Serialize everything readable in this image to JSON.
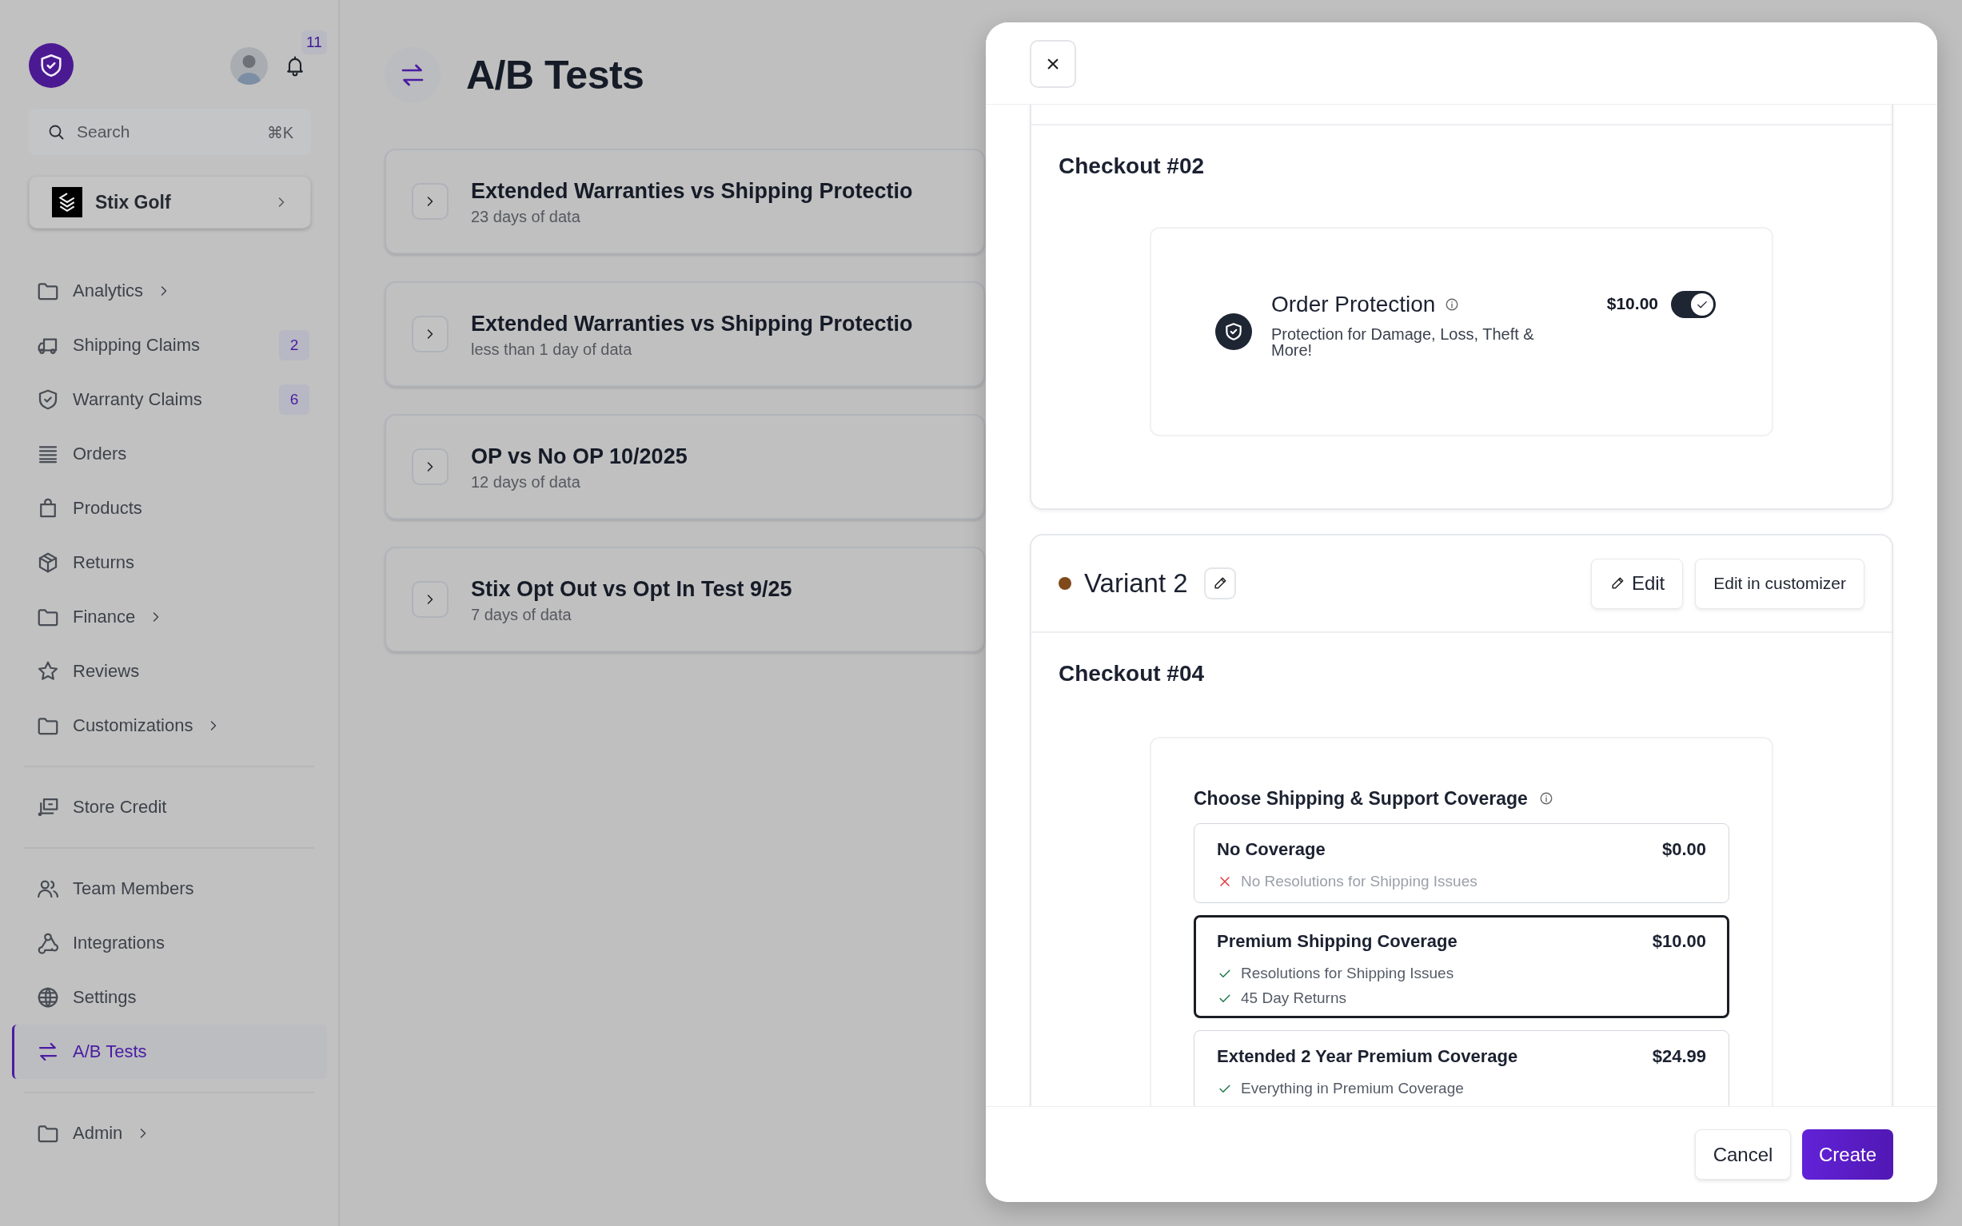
{
  "sidebar": {
    "notifications": "11",
    "search": {
      "placeholder": "Search",
      "shortcut": "⌘K"
    },
    "store": {
      "name": "Stix Golf"
    },
    "sections": [
      {
        "items": [
          {
            "label": "Analytics",
            "submenu": true,
            "selected": false
          },
          {
            "label": "Shipping Claims",
            "badge": "2",
            "submenu": false,
            "selected": false
          },
          {
            "label": "Warranty Claims",
            "badge": "6",
            "submenu": false,
            "selected": false
          },
          {
            "label": "Orders",
            "submenu": false,
            "selected": false
          },
          {
            "label": "Products",
            "submenu": false,
            "selected": false
          },
          {
            "label": "Returns",
            "submenu": false,
            "selected": false
          },
          {
            "label": "Finance",
            "submenu": true,
            "selected": false
          },
          {
            "label": "Reviews",
            "submenu": false,
            "selected": false
          },
          {
            "label": "Customizations",
            "submenu": true,
            "selected": false
          }
        ]
      },
      {
        "items": [
          {
            "label": "Store Credit",
            "submenu": false,
            "selected": false
          }
        ]
      },
      {
        "items": [
          {
            "label": "Team Members",
            "submenu": false,
            "selected": false
          },
          {
            "label": "Integrations",
            "submenu": false,
            "selected": false
          },
          {
            "label": "Settings",
            "submenu": false,
            "selected": false
          },
          {
            "label": "A/B Tests",
            "submenu": false,
            "selected": true
          }
        ]
      },
      {
        "items": [
          {
            "label": "Admin",
            "submenu": true,
            "selected": false
          }
        ]
      }
    ]
  },
  "page": {
    "title": "A/B Tests",
    "tests": [
      {
        "title": "Extended Warranties vs Shipping Protectio",
        "subtitle": "23 days of data"
      },
      {
        "title": "Extended Warranties vs Shipping Protectio",
        "subtitle": "less than 1 day of data"
      },
      {
        "title": "OP vs No OP 10/2025",
        "subtitle": "12 days of data"
      },
      {
        "title": "Stix Opt Out vs Opt In Test 9/25",
        "subtitle": "7 days of data"
      }
    ]
  },
  "modal": {
    "close": "×",
    "variants": [
      {
        "checkout": "Checkout #02",
        "widget": {
          "kind": "toggle",
          "title": "Order Protection",
          "description": "Protection for Damage, Loss, Theft & More!",
          "price": "$10.00",
          "on": true
        }
      },
      {
        "name": "Variant 2",
        "color": "#80491c",
        "actions": [
          {
            "label": "Edit",
            "kind": "icon"
          },
          {
            "label": "Edit in customizer",
            "kind": "plain"
          }
        ],
        "checkout": "Checkout #04",
        "widget": {
          "kind": "coverage",
          "title": "Choose Shipping & Support Coverage",
          "options": [
            {
              "title": "No Coverage",
              "price": "$0.00",
              "selected": false,
              "features": [
                {
                  "text": "No Resolutions for Shipping Issues",
                  "included": false
                }
              ]
            },
            {
              "title": "Premium Shipping Coverage",
              "price": "$10.00",
              "selected": true,
              "features": [
                {
                  "text": "Resolutions for Shipping Issues",
                  "included": true
                },
                {
                  "text": "45 Day Returns",
                  "included": true
                }
              ]
            },
            {
              "title": "Extended 2 Year Premium Coverage",
              "price": "$24.99",
              "selected": false,
              "features": [
                {
                  "text": "Everything in Premium Coverage",
                  "included": true
                }
              ]
            }
          ]
        }
      }
    ],
    "footer": [
      {
        "label": "Cancel",
        "kind": "secondary"
      },
      {
        "label": "Create",
        "kind": "primary"
      }
    ]
  }
}
